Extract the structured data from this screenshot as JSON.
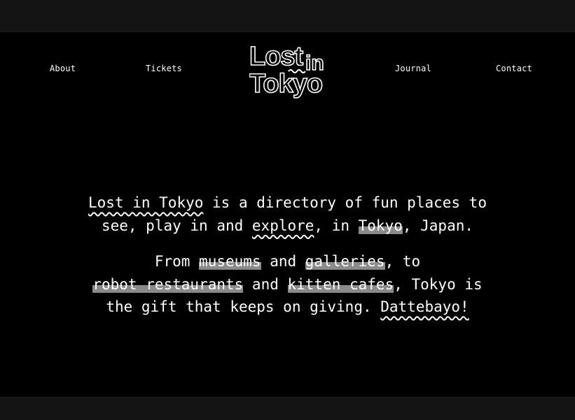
{
  "nav": {
    "about": "About",
    "tickets": "Tickets",
    "journal": "Journal",
    "contact": "Contact"
  },
  "logo": {
    "line1": "Lost",
    "line1b": "in",
    "line2": "Tokyo"
  },
  "intro": {
    "p1": {
      "l1_link": "Lost in Tokyo",
      "l1_text": " is a directory of fun places to",
      "l2_text_a": "see, play in and ",
      "l2_link_explore": "explore",
      "l2_text_b": ", in ",
      "l2_link_tokyo": "Tokyo",
      "l2_text_c": ", Japan."
    },
    "p2": {
      "l1_text_a": "From ",
      "l1_link_museums": "museums",
      "l1_text_b": " and ",
      "l1_link_galleries": "galleries",
      "l1_text_c": ", to",
      "l2_link_robot": "robot restaurants",
      "l2_text_a": " and ",
      "l2_link_kitten": "kitten cafes",
      "l2_text_b": ", Tokyo is",
      "l3_text": "the gift that keeps on giving. ",
      "l3_link_dattebayo": "Dattebayo!"
    }
  },
  "colors": {
    "page_bg": "#141414",
    "frame_bg": "#000000",
    "text": "#ffffff",
    "highlight": "#8a8a8a"
  }
}
